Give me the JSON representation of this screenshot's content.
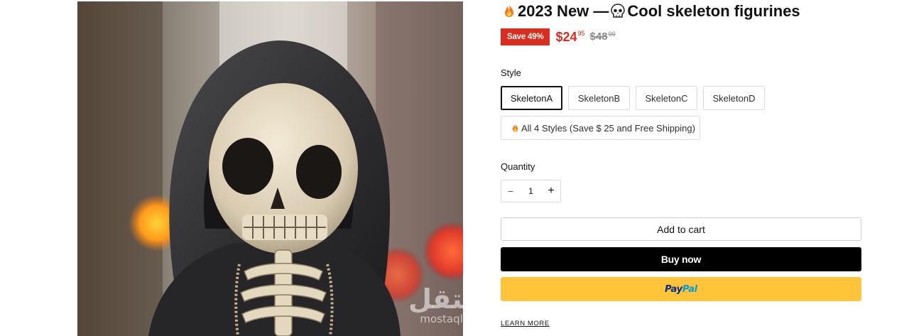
{
  "product": {
    "title_text": "2023 New —",
    "title_text2": "Cool skeleton figurines",
    "title_icons": [
      "fire-icon",
      "skull-icon"
    ],
    "image_alt": "Hooded skeleton figurine"
  },
  "price": {
    "save_badge": "Save 49%",
    "current_main": "$24",
    "current_cents": "95",
    "compare_main": "$48",
    "compare_cents": "99",
    "accent_color": "#da2c1f"
  },
  "style": {
    "label": "Style",
    "options": [
      {
        "label": "SkeletonA",
        "selected": true
      },
      {
        "label": "SkeletonB",
        "selected": false
      },
      {
        "label": "SkeletonC",
        "selected": false
      },
      {
        "label": "SkeletonD",
        "selected": false
      }
    ],
    "bundle_option": "All 4 Styles (Save  $ 25 and Free Shipping)"
  },
  "quantity": {
    "label": "Quantity",
    "value": "1",
    "minus": "−",
    "plus": "+"
  },
  "actions": {
    "add_to_cart": "Add to cart",
    "buy_now": "Buy now",
    "paypal_pay": "Pay",
    "paypal_pal": "Pal",
    "learn_more": "LEARN MORE"
  },
  "watermark": {
    "arabic": "مستقل",
    "latin": "mostaql.com"
  }
}
